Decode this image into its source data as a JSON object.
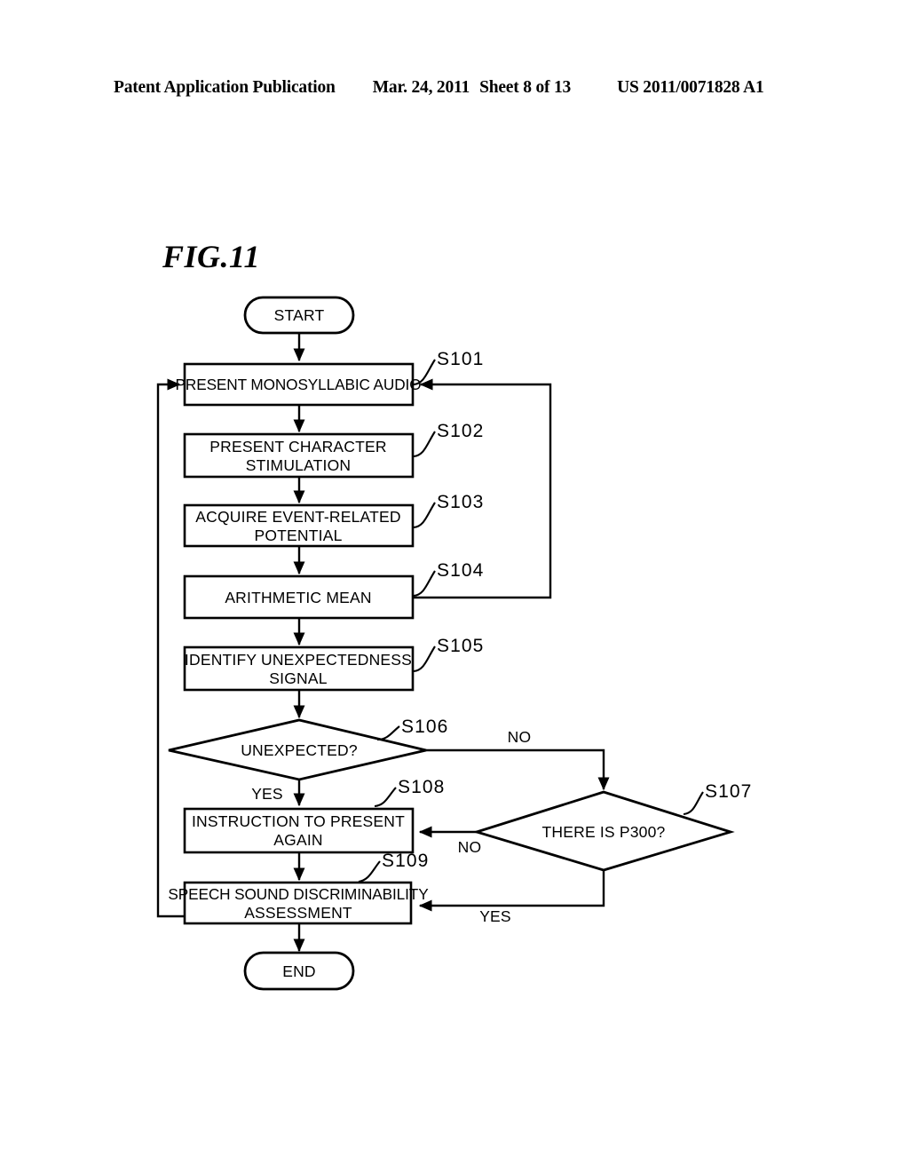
{
  "header": {
    "publication": "Patent Application Publication",
    "date": "Mar. 24, 2011",
    "sheet": "Sheet 8 of 13",
    "number": "US 2011/0071828 A1"
  },
  "figure": {
    "label": "FIG.11",
    "type": "flowchart"
  },
  "flowchart": {
    "terminators": {
      "start": "START",
      "end": "END"
    },
    "steps": [
      {
        "id": "S101",
        "label": "PRESENT MONOSYLLABIC AUDIO",
        "shape": "process"
      },
      {
        "id": "S102",
        "label_line1": "PRESENT CHARACTER",
        "label_line2": "STIMULATION",
        "shape": "process"
      },
      {
        "id": "S103",
        "label_line1": "ACQUIRE EVENT-RELATED",
        "label_line2": "POTENTIAL",
        "shape": "process"
      },
      {
        "id": "S104",
        "label": "ARITHMETIC MEAN",
        "shape": "process"
      },
      {
        "id": "S105",
        "label_line1": "IDENTIFY UNEXPECTEDNESS",
        "label_line2": "SIGNAL",
        "shape": "process"
      },
      {
        "id": "S106",
        "label": "UNEXPECTED?",
        "shape": "decision"
      },
      {
        "id": "S107",
        "label": "THERE IS P300?",
        "shape": "decision"
      },
      {
        "id": "S108",
        "label_line1": "INSTRUCTION TO PRESENT",
        "label_line2": "AGAIN",
        "shape": "process"
      },
      {
        "id": "S109",
        "label_line1": "SPEECH SOUND DISCRIMINABILITY",
        "label_line2": "ASSESSMENT",
        "shape": "process"
      }
    ],
    "edge_labels": {
      "s106_no": "NO",
      "s106_yes": "YES",
      "s107_no": "NO",
      "s107_yes": "YES"
    },
    "colors": {
      "stroke": "#000000",
      "fill": "#ffffff"
    }
  }
}
